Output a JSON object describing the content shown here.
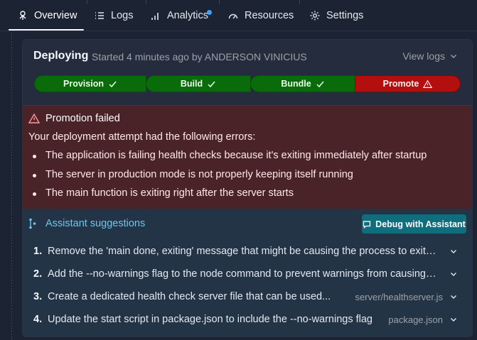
{
  "tabs": [
    {
      "label": "Overview",
      "icon": "overview-icon",
      "active": true
    },
    {
      "label": "Logs",
      "icon": "logs-icon"
    },
    {
      "label": "Analytics",
      "icon": "analytics-icon",
      "has_dot": true
    },
    {
      "label": "Resources",
      "icon": "gauge-icon"
    },
    {
      "label": "Settings",
      "icon": "gear-icon"
    }
  ],
  "deployment": {
    "title": "Deploying",
    "meta": "Started 4 minutes ago by ANDERSON VINICIUS",
    "view_logs": "View logs"
  },
  "pipeline": [
    {
      "label": "Provision",
      "status": "success"
    },
    {
      "label": "Build",
      "status": "success"
    },
    {
      "label": "Bundle",
      "status": "success"
    },
    {
      "label": "Promote",
      "status": "failed"
    }
  ],
  "error": {
    "title": "Promotion failed",
    "intro": "Your deployment attempt had the following errors:",
    "items": [
      "The application is failing health checks because it's exiting immediately after startup",
      "The server in production mode is not properly keeping itself running",
      "The main function is exiting right after the server starts"
    ]
  },
  "assistant": {
    "title": "Assistant suggestions",
    "debug_button": "Debug with Assistant",
    "suggestions": [
      {
        "num": "1.",
        "text": "Remove the 'main done, exiting' message that might be causing the process to exit afte...",
        "file": ""
      },
      {
        "num": "2.",
        "text": "Add the --no-warnings flag to the node command to prevent warnings from causing ear...",
        "file": ""
      },
      {
        "num": "3.",
        "text": "Create a dedicated health check server file that can be used...",
        "file": "server/healthserver.js"
      },
      {
        "num": "4.",
        "text": "Update the start script in package.json to include the --no-warnings flag",
        "file": "package.json"
      }
    ]
  },
  "colors": {
    "success": "#0a6b0a",
    "failed": "#b30f0f",
    "error_bg": "#4a2328",
    "assistant_bg": "#243447",
    "accent": "#6dc6ee",
    "button": "#0e6e7e"
  }
}
